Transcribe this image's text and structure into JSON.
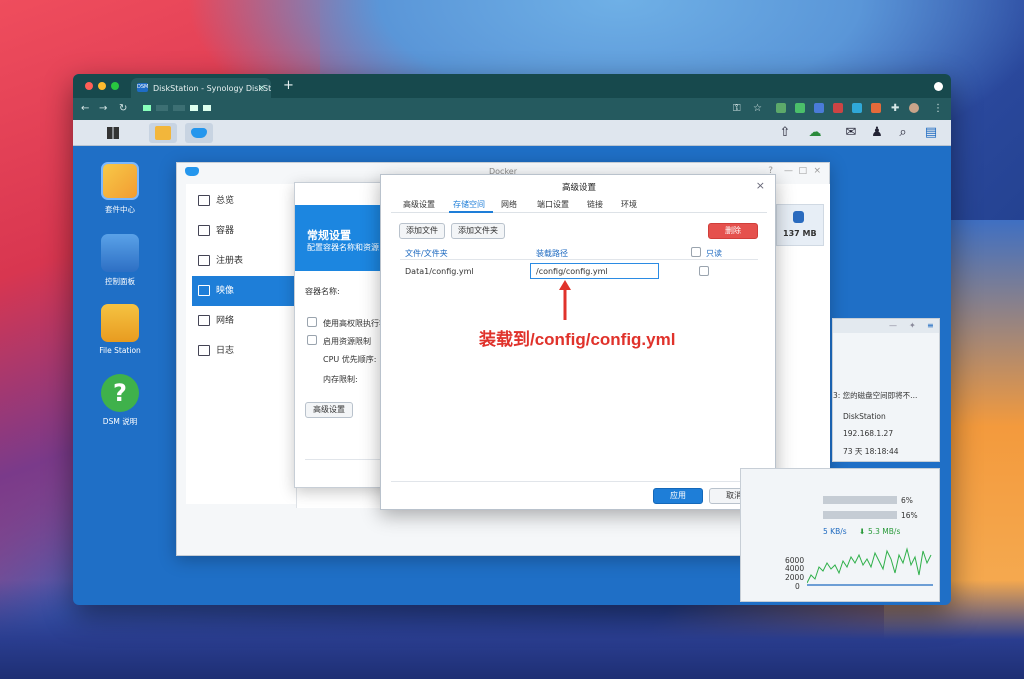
{
  "browser": {
    "tab_title": "DiskStation - Synology DiskSta",
    "tab_favicon": "DSM",
    "new_tab": "+",
    "close_tab": "×"
  },
  "desktop": {
    "icons": [
      {
        "label": "套件中心",
        "icon": "package-center-icon"
      },
      {
        "label": "控制面板",
        "icon": "control-panel-icon"
      },
      {
        "label": "File Station",
        "icon": "file-station-icon"
      },
      {
        "label": "DSM 说明",
        "icon": "help-icon"
      }
    ]
  },
  "docker_window": {
    "title": "Docker",
    "sidebar": [
      {
        "label": "总览",
        "icon": "overview-icon"
      },
      {
        "label": "容器",
        "icon": "container-icon"
      },
      {
        "label": "注册表",
        "icon": "registry-icon"
      },
      {
        "label": "映像",
        "icon": "image-icon",
        "active": true
      },
      {
        "label": "网络",
        "icon": "network-icon"
      },
      {
        "label": "日志",
        "icon": "log-icon"
      }
    ],
    "storage_value": "137 MB"
  },
  "general_settings": {
    "title": "常规设置",
    "subtitle": "配置容器名称和资源",
    "container_name_label": "容器名称:",
    "high_priv_label": "使用高权限执行容",
    "resource_limit_label": "启用资源限制",
    "cpu_label": "CPU 优先顺序:",
    "memory_label": "内存限制:",
    "advanced_button": "高级设置"
  },
  "advanced_settings": {
    "title": "高级设置",
    "tabs": [
      "高级设置",
      "存储空间",
      "网络",
      "端口设置",
      "链接",
      "环境"
    ],
    "active_tab": 1,
    "add_file_button": "添加文件",
    "add_folder_button": "添加文件夹",
    "delete_button": "删除",
    "columns": {
      "file": "文件/文件夹",
      "mount_path": "装载路径",
      "readonly": "只读"
    },
    "rows": [
      {
        "file": "Data1/config.yml",
        "mount_path": "/config/config.yml"
      }
    ],
    "apply_button": "应用",
    "cancel_button": "取消"
  },
  "annotation": "装载到/config/config.yml",
  "widgets": {
    "notice": "3:  您的磁盘空间即将不...",
    "server_name": "DiskStation",
    "ip": "192.168.1.27",
    "uptime": "73 天 18:18:44",
    "cpu_percent": 6,
    "cpu_text": "6%",
    "ram_percent": 16,
    "ram_text": "16%",
    "upload_speed": "5 KB/s",
    "download_speed": "5.3 MB/s",
    "chart_ticks": [
      "6000",
      "4000",
      "2000",
      "0"
    ]
  },
  "colors": {
    "accent": "#1e7ed8",
    "danger": "#e5514d",
    "annotation": "#e0322b"
  }
}
